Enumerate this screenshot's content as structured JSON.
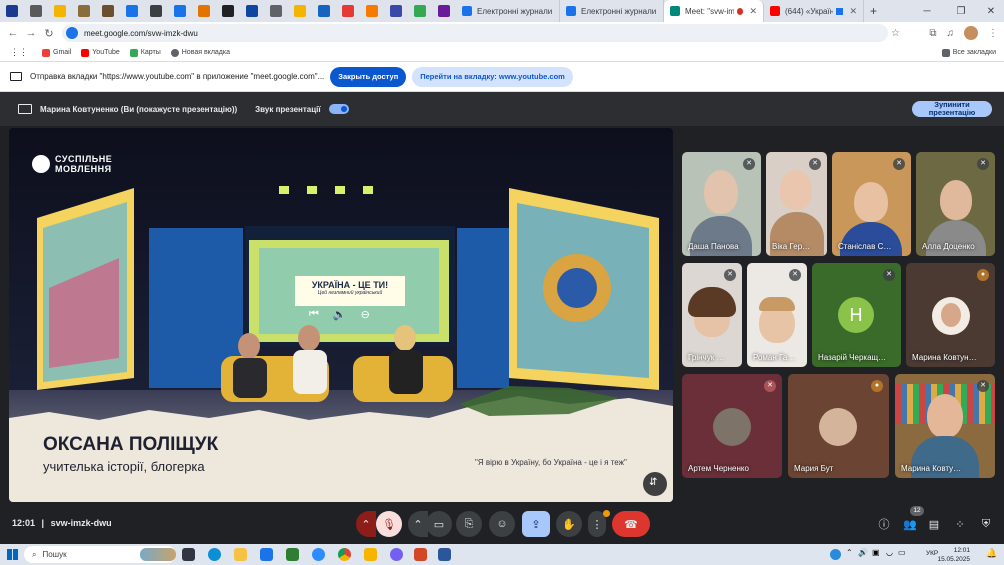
{
  "browser": {
    "tabs": [
      {
        "title": "Електронні журнали",
        "favicon_color": "#1a73e8"
      },
      {
        "title": "Електронні журнали",
        "favicon_color": "#1a73e8"
      },
      {
        "title": "Meet: \"svw-imzk-dwu\"",
        "favicon_color": "#00897b",
        "active": true
      },
      {
        "title": "(644) «Україна — ц…",
        "favicon_color": "#ff0000"
      }
    ],
    "url": "meet.google.com/svw-imzk-dwu",
    "bookmarks": [
      {
        "label": "Gmail",
        "color": "#ea4335"
      },
      {
        "label": "YouTube",
        "color": "#ff0000"
      },
      {
        "label": "Карты",
        "color": "#34a853"
      },
      {
        "label": "Новая вкладка",
        "color": "#5f6368"
      }
    ],
    "all_bookmarks": "Все закладки"
  },
  "infobar": {
    "message": "Отправка вкладки \"https://www.youtube.com\" в приложение \"meet.google.com\"...",
    "stop_button": "Закрыть доступ",
    "switch_button": "Перейти на вкладку: www.youtube.com"
  },
  "presentation": {
    "presenter": "Марина Ковтуненко (Ви (покажусте презентацію))",
    "audio_label": "Звук презентації",
    "audio_on": true,
    "stop_label_line1": "Зупинити",
    "stop_label_line2": "презентацію"
  },
  "video": {
    "channel_logo": "СУСПІЛЬНЕ МОВЛЕННЯ",
    "sign_title": "УКРАЇНА - ЦЕ ТИ!",
    "sign_sub": "Цей незламний український",
    "guest_name": "ОКСАНА ПОЛІЩУК",
    "guest_role": "учителька історії, блогерка",
    "quote": "\"Я вірю в Україну, бо Україна - це і я теж\""
  },
  "participants": [
    {
      "name": "Даша Панова",
      "mic": "muted"
    },
    {
      "name": "Віка Гер…",
      "mic": "muted"
    },
    {
      "name": "Станіслав С…",
      "mic": "muted"
    },
    {
      "name": "Алла Доценко",
      "mic": "muted"
    },
    {
      "name": "Грінчук …",
      "mic": "muted"
    },
    {
      "name": "Роман Га…",
      "mic": "muted"
    },
    {
      "name": "Назарій Черкащ…",
      "mic": "muted",
      "initial": "H"
    },
    {
      "name": "Марина Ковтун…",
      "mic": "orange"
    },
    {
      "name": "Артем Черненко",
      "mic": "red"
    },
    {
      "name": "Мария Бут",
      "mic": "orange"
    },
    {
      "name": "Марина Ковту…",
      "mic": "muted"
    }
  ],
  "meeting": {
    "time": "12:01",
    "code": "svw-imzk-dwu",
    "participant_count": "12"
  },
  "taskbar": {
    "search_placeholder": "Пошук",
    "lang": "УКР",
    "clock_time": "12:01",
    "clock_date": "15.05.2025"
  }
}
